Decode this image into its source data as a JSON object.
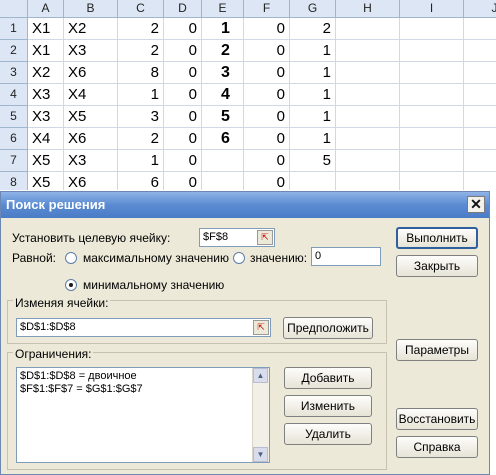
{
  "spreadsheet": {
    "columns": [
      "A",
      "B",
      "C",
      "D",
      "E",
      "F",
      "G",
      "H",
      "I",
      "J"
    ],
    "rows": [
      {
        "num": "1",
        "cells": [
          "X1",
          "X2",
          "2",
          "0",
          "1",
          "0",
          "2",
          "",
          "",
          ""
        ]
      },
      {
        "num": "2",
        "cells": [
          "X1",
          "X3",
          "2",
          "0",
          "2",
          "0",
          "1",
          "",
          "",
          ""
        ]
      },
      {
        "num": "3",
        "cells": [
          "X2",
          "X6",
          "8",
          "0",
          "3",
          "0",
          "1",
          "",
          "",
          ""
        ]
      },
      {
        "num": "4",
        "cells": [
          "X3",
          "X4",
          "1",
          "0",
          "4",
          "0",
          "1",
          "",
          "",
          ""
        ]
      },
      {
        "num": "5",
        "cells": [
          "X3",
          "X5",
          "3",
          "0",
          "5",
          "0",
          "1",
          "",
          "",
          ""
        ]
      },
      {
        "num": "6",
        "cells": [
          "X4",
          "X6",
          "2",
          "0",
          "6",
          "0",
          "1",
          "",
          "",
          ""
        ]
      },
      {
        "num": "7",
        "cells": [
          "X5",
          "X3",
          "1",
          "0",
          "",
          "0",
          "5",
          "",
          "",
          ""
        ]
      },
      {
        "num": "8",
        "cells": [
          "X5",
          "X6",
          "6",
          "0",
          "",
          "0",
          "",
          "",
          "",
          ""
        ]
      }
    ]
  },
  "dialog": {
    "title": "Поиск решения",
    "target_label": "Установить целевую ячейку:",
    "target_value": "$F$8",
    "equal_label": "Равной:",
    "radio_max": "максимальному значению",
    "radio_value": "значению:",
    "value_field": "0",
    "radio_min": "минимальному значению",
    "min_selected": true,
    "changing_label": "Изменяя ячейки:",
    "changing_value": "$D$1:$D$8",
    "constraints_label": "Ограничения:",
    "constraints": [
      "$D$1:$D$8 = двоичное",
      "$F$1:$F$7 = $G$1:$G$7"
    ],
    "buttons": {
      "solve": "Выполнить",
      "close": "Закрыть",
      "guess": "Предположить",
      "options": "Параметры",
      "add": "Добавить",
      "change": "Изменить",
      "delete": "Удалить",
      "reset": "Восстановить",
      "help": "Справка"
    },
    "close_glyph": "✕",
    "ref_glyph": "⇱"
  }
}
